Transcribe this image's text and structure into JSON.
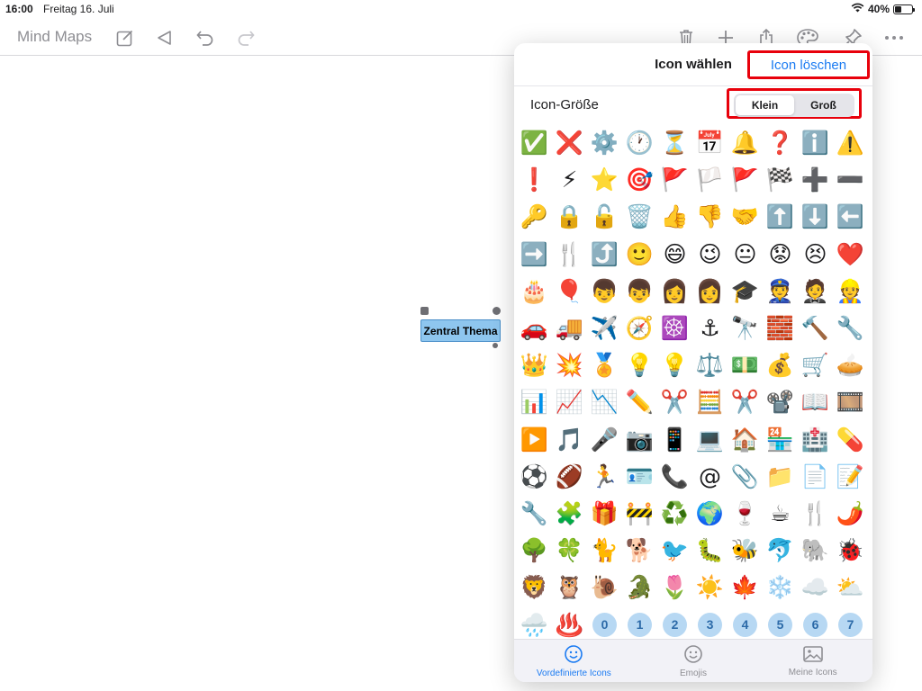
{
  "statusbar": {
    "time": "16:00",
    "date": "Freitag 16. Juli",
    "battery": "40%",
    "battery_level": 0.4
  },
  "toolbar": {
    "app_title": "Mind Maps",
    "left_icons": [
      "compose-icon",
      "back-triangle-icon",
      "undo-icon",
      "redo-icon"
    ],
    "right_icons": [
      "trash-icon",
      "plus-icon",
      "share-icon",
      "palette-icon",
      "pin-icon",
      "more-icon"
    ]
  },
  "canvas": {
    "node_label": "Zentral Thema"
  },
  "popover": {
    "title": "Icon wählen",
    "clear_button": "Icon löschen",
    "size_label": "Icon-Größe",
    "size_options": [
      "Klein",
      "Groß"
    ],
    "size_selected": "Klein",
    "icons": [
      "✅",
      "❌",
      "⚙️",
      "🕐",
      "⏳",
      "📅",
      "🔔",
      "❓",
      "ℹ️",
      "⚠️",
      "❗",
      "⚡",
      "⭐",
      "🎯",
      "🚩",
      "🏳️",
      "🚩",
      "🏁",
      "➕",
      "➖",
      "🔑",
      "🔒",
      "🔓",
      "🗑️",
      "👍",
      "👎",
      "🤝",
      "⬆️",
      "⬇️",
      "⬅️",
      "➡️",
      "🍴",
      "⤴️",
      "🙂",
      "😄",
      "😉",
      "😐",
      "😟",
      "😣",
      "❤️",
      "🎂",
      "🎈",
      "👦",
      "👦",
      "👩",
      "👩",
      "🎓",
      "👮",
      "🤵",
      "👷",
      "🚗",
      "🚚",
      "✈️",
      "🧭",
      "☸️",
      "⚓",
      "🔭",
      "🧱",
      "🔨",
      "🔧",
      "👑",
      "💥",
      "🏅",
      "💡",
      "💡",
      "⚖️",
      "💵",
      "💰",
      "🛒",
      "🥧",
      "📊",
      "📈",
      "📉",
      "✏️",
      "✂️",
      "🧮",
      "✂️",
      "📽️",
      "📖",
      "🎞️",
      "▶️",
      "🎵",
      "🎤",
      "📷",
      "📱",
      "💻",
      "🏠",
      "🏪",
      "🏥",
      "💊",
      "⚽",
      "🏈",
      "🏃",
      "🪪",
      "📞",
      "@",
      "📎",
      "📁",
      "📄",
      "📝",
      "🔧",
      "🧩",
      "🎁",
      "🚧",
      "♻️",
      "🌍",
      "🍷",
      "☕",
      "🍴",
      "🌶️",
      "🌳",
      "🍀",
      "🐈",
      "🐕",
      "🐦",
      "🐛",
      "🐝",
      "🐬",
      "🐘",
      "🐞",
      "🦁",
      "🦉",
      "🐌",
      "🐊",
      "🌷",
      "☀️",
      "🍁",
      "❄️",
      "☁️",
      "⛅",
      "🌧️",
      "♨️",
      "0",
      "1",
      "2",
      "3",
      "4",
      "5",
      "6",
      "7"
    ],
    "tabs": [
      {
        "label": "Vordefinierte Icons",
        "icon": "smiley-icon"
      },
      {
        "label": "Emojis",
        "icon": "smiley-icon"
      },
      {
        "label": "Meine Icons",
        "icon": "image-icon"
      }
    ],
    "active_tab": "Vordefinierte Icons",
    "accent_color": "#1b7bf2",
    "highlight_color": "#e8000b"
  }
}
